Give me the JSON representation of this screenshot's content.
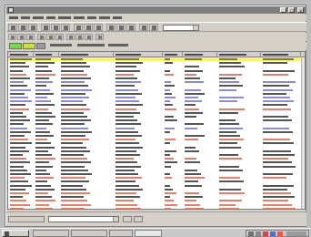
{
  "window": {
    "title": "",
    "controls": {
      "minimize_glyph": "_",
      "maximize_glyph": "□",
      "close_glyph": "×"
    }
  },
  "menu": {
    "items": [
      "",
      "",
      "",
      "",
      "",
      "",
      "",
      "",
      ""
    ]
  },
  "toolbar": {
    "combo_value": ""
  },
  "filterbar": {
    "chips": [
      {
        "color": "#7cd455"
      },
      {
        "color": "#c9e04a"
      },
      {
        "color": "#9a9a9a"
      }
    ]
  },
  "table": {
    "columns": [
      "",
      "",
      "",
      "",
      "",
      "",
      "",
      ""
    ],
    "selected_row_color": "#f7f56a",
    "row_kinds": [
      "selected",
      "plain",
      "plain",
      "plain",
      "orange",
      "plain",
      "purple",
      "plain",
      "purple",
      "plain",
      "purple",
      "purple",
      "plain",
      "orange",
      "plain",
      "plain",
      "plain",
      "plain",
      "purple",
      "plain",
      "plain",
      "orange",
      "plain",
      "plain",
      "plain",
      "plain",
      "orange",
      "plain",
      "plain",
      "plain",
      "plain",
      "orange",
      "plain",
      "plain",
      "plain",
      "orange",
      "plain",
      "orange",
      "orange",
      "orange"
    ],
    "text_colors": {
      "plain": "#555555",
      "orange": "#e08070",
      "purple": "#8c8cd0"
    }
  },
  "statusbar": {
    "combo_value": ""
  },
  "taskbar": {
    "start_label": "",
    "tasks": [
      "",
      "",
      "",
      ""
    ]
  }
}
